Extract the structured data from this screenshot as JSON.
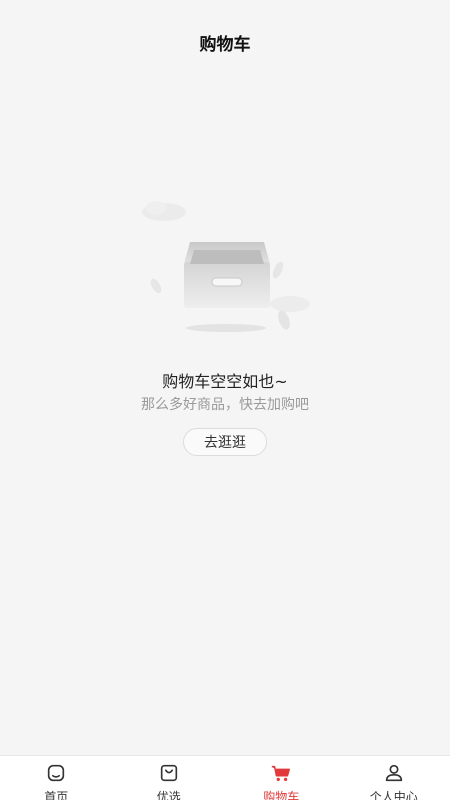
{
  "header": {
    "title": "购物车"
  },
  "empty_state": {
    "title": "购物车空空如也~",
    "subtitle": "那么多好商品，快去加购吧",
    "button_label": "去逛逛"
  },
  "tabbar": {
    "active_color": "#e23a3a",
    "items": [
      {
        "label": "首页",
        "icon": "home-icon"
      },
      {
        "label": "优选",
        "icon": "shopping-bag-icon"
      },
      {
        "label": "购物车",
        "icon": "cart-icon",
        "active": true
      },
      {
        "label": "个人中心",
        "icon": "user-icon"
      }
    ]
  }
}
